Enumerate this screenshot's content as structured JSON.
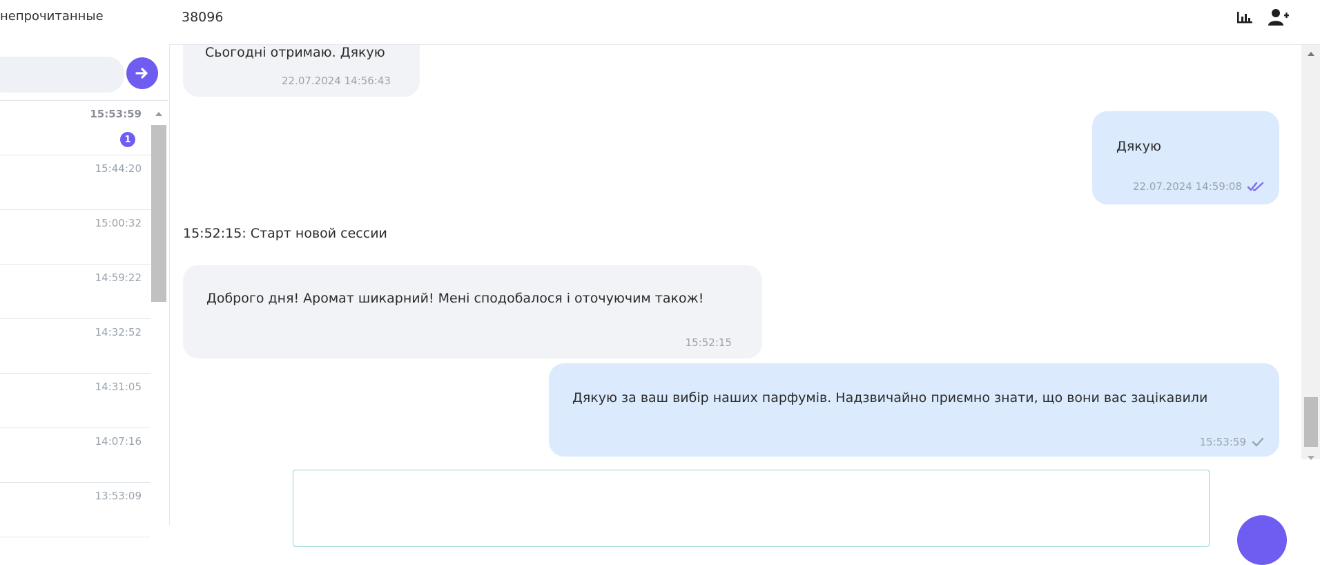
{
  "left_panel": {
    "unread_filter_label": "непрочитанные",
    "search_placeholder": "",
    "go_icon": "arrow-right-circle-icon",
    "chats": [
      {
        "time": "15:53:59",
        "unread": "1"
      },
      {
        "time": "15:44:20"
      },
      {
        "time": "15:00:32"
      },
      {
        "time": "14:59:22"
      },
      {
        "time": "14:32:52"
      },
      {
        "time": "14:31:05"
      },
      {
        "time": "14:07:16"
      },
      {
        "time": "13:53:09"
      }
    ]
  },
  "header": {
    "phone": "38096",
    "icons": [
      "bar-chart-icon",
      "add-user-icon"
    ]
  },
  "messages": [
    {
      "direction": "in",
      "text": "Сьогодні отримаю. Дякую",
      "time": "22.07.2024 14:56:43"
    },
    {
      "direction": "out",
      "text": "Дякую",
      "time": "22.07.2024 14:59:08",
      "status": "read"
    },
    {
      "type": "session",
      "text": "15:52:15: Старт новой сессии"
    },
    {
      "direction": "in",
      "text": "Доброго дня! Аромат шикарний! Мені сподобалося і оточуючим також!",
      "time": "15:52:15"
    },
    {
      "direction": "out",
      "text": "Дякую за ваш вибір наших парфумів. Надзвичайно приємно знати, що вони вас зацікавили",
      "time": "15:53:59",
      "status": "sent"
    }
  ],
  "composer": {
    "placeholder": ""
  },
  "colors": {
    "accent": "#6f5cf0",
    "incoming_bubble": "#f1f3f6",
    "outgoing_bubble": "#dbeafc",
    "read_tick": "#7b6cf0",
    "sent_tick": "#9aa3ad"
  }
}
